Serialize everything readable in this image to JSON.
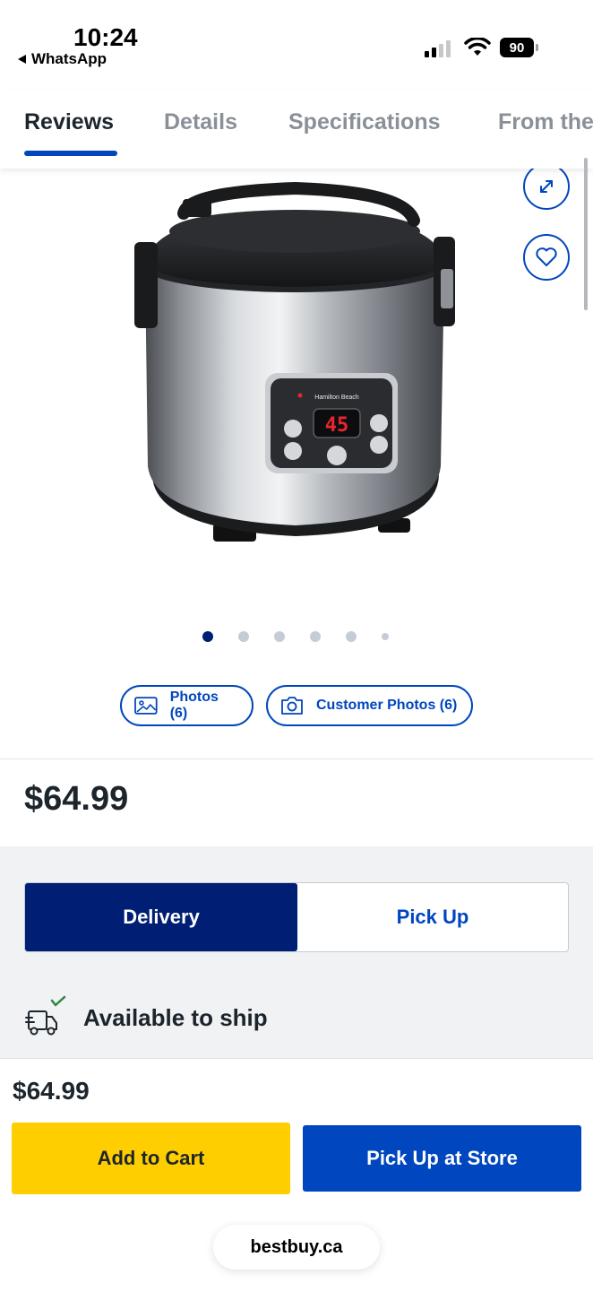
{
  "status_bar": {
    "time": "10:24",
    "back_app": "WhatsApp",
    "battery": "90"
  },
  "tabs": [
    {
      "label": "Reviews",
      "active": true
    },
    {
      "label": "Details",
      "active": false
    },
    {
      "label": "Specifications",
      "active": false
    },
    {
      "label": "From the",
      "active": false
    }
  ],
  "product": {
    "image_icon": "rice-cooker-image",
    "display_brand": "Hamilton Beach",
    "display_digits": "45",
    "carousel": {
      "count": 6,
      "active_index": 0
    }
  },
  "media_buttons": {
    "photos": "Photos (6)",
    "customer_photos": "Customer Photos (6)"
  },
  "price": "$64.99",
  "fulfillment": {
    "delivery_label": "Delivery",
    "pickup_label": "Pick Up",
    "selected": "Delivery",
    "availability": "Available to ship"
  },
  "bottom_bar": {
    "price": "$64.99",
    "add_to_cart": "Add to Cart",
    "pick_up_at_store": "Pick Up at Store"
  },
  "browser": {
    "url": "bestbuy.ca"
  },
  "colors": {
    "brand_blue": "#0046be",
    "navy": "#001e73",
    "yellow": "#ffce00",
    "check_green": "#2e8540"
  }
}
